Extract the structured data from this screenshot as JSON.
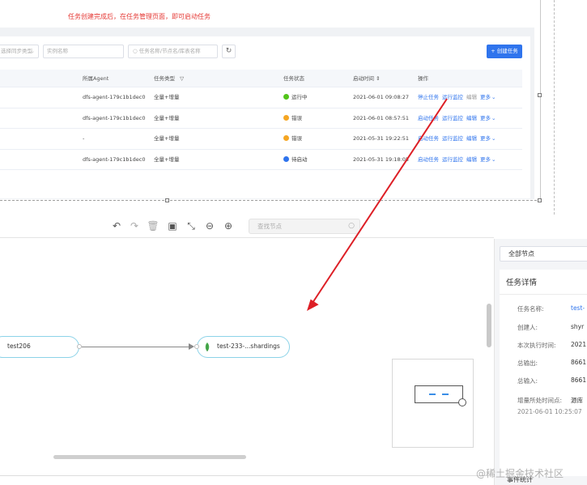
{
  "task_list": {
    "banner": "任务创建完成后，在任务管理页面，即可启动任务",
    "filters": {
      "sync_type_placeholder": "选择同步类型",
      "instance_placeholder": "实例名称",
      "search_placeholder": "任务名称/节点名/库表名称"
    },
    "create_button": "+ 创建任务",
    "columns": {
      "agent": "所属Agent",
      "task_type": "任务类型",
      "task_status": "任务状态",
      "start_time": "启动时间",
      "actions": "操作"
    },
    "rows": [
      {
        "agent": "dfs-agent-179c1b1dec0",
        "task_type": "全量+增量",
        "status": "运行中",
        "status_color": "#52c41a",
        "start_time": "2021-06-01 09:08:27",
        "actions": [
          "停止任务",
          "运行监控",
          "编辑",
          "更多"
        ]
      },
      {
        "agent": "dfs-agent-179c1b1dec0",
        "task_type": "全量+增量",
        "status": "错误",
        "status_color": "#f5a623",
        "start_time": "2021-06-01 08:57:51",
        "actions": [
          "启动任务",
          "运行监控",
          "编辑",
          "更多"
        ]
      },
      {
        "agent": "-",
        "task_type": "全量+增量",
        "status": "错误",
        "status_color": "#f5a623",
        "start_time": "2021-05-31 19:22:51",
        "actions": [
          "启动任务",
          "运行监控",
          "编辑",
          "更多"
        ]
      },
      {
        "agent": "dfs-agent-179c1b1dec0",
        "task_type": "全量+增量",
        "status": "待启动",
        "status_color": "#2f74ed",
        "start_time": "2021-05-31 19:18:05",
        "actions": [
          "启动任务",
          "运行监控",
          "编辑",
          "更多"
        ]
      }
    ]
  },
  "toolbar": {
    "search_placeholder": "查找节点"
  },
  "canvas": {
    "source_node": "test206",
    "target_node": "test-233-...shardings"
  },
  "side_panel": {
    "node_filter": "全部节点",
    "title": "任务详情",
    "fields": [
      {
        "label": "任务名称:",
        "value": "test-"
      },
      {
        "label": "创建人:",
        "value": "shyr"
      },
      {
        "label": "本次执行时间:",
        "value": "2021"
      },
      {
        "label": "总输出:",
        "value": "8661"
      },
      {
        "label": "总输入:",
        "value": "8661"
      },
      {
        "label": "增量所处时间点:",
        "value": "源库"
      }
    ],
    "timestamp": "2021-06-01 10:25:07",
    "event_stats": "事件统计"
  },
  "watermark": "@稀土掘金技术社区",
  "colors": {
    "primary_blue": "#2f74ed",
    "banner_red": "#e53935",
    "arrow_red": "#dd1f26",
    "node_border": "#8cd3e8",
    "leaf_green": "#4caf50"
  }
}
